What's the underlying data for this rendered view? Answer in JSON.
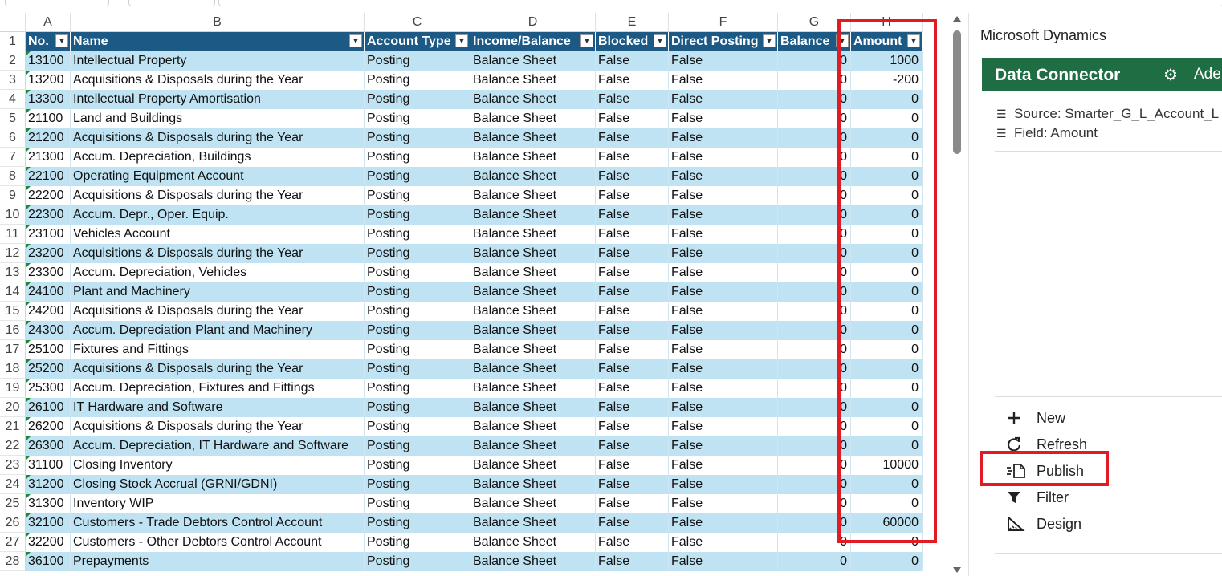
{
  "columns": [
    "A",
    "B",
    "C",
    "D",
    "E",
    "F",
    "G",
    "H"
  ],
  "headers": {
    "no": "No.",
    "name": "Name",
    "account_type": "Account Type",
    "income_balance": "Income/Balance",
    "blocked": "Blocked",
    "direct_posting": "Direct Posting",
    "balance": "Balance",
    "amount": "Amount"
  },
  "rows": [
    {
      "row": "2",
      "no": "13100",
      "name": "Intellectual Property",
      "type": "Posting",
      "ib": "Balance Sheet",
      "blocked": "False",
      "direct": "False",
      "balance": "0",
      "amount": "1000"
    },
    {
      "row": "3",
      "no": "13200",
      "name": "Acquisitions & Disposals during the Year",
      "type": "Posting",
      "ib": "Balance Sheet",
      "blocked": "False",
      "direct": "False",
      "balance": "0",
      "amount": "-200"
    },
    {
      "row": "4",
      "no": "13300",
      "name": "Intellectual Property Amortisation",
      "type": "Posting",
      "ib": "Balance Sheet",
      "blocked": "False",
      "direct": "False",
      "balance": "0",
      "amount": "0"
    },
    {
      "row": "5",
      "no": "21100",
      "name": "Land and Buildings",
      "type": "Posting",
      "ib": "Balance Sheet",
      "blocked": "False",
      "direct": "False",
      "balance": "0",
      "amount": "0"
    },
    {
      "row": "6",
      "no": "21200",
      "name": "Acquisitions & Disposals during the Year",
      "type": "Posting",
      "ib": "Balance Sheet",
      "blocked": "False",
      "direct": "False",
      "balance": "0",
      "amount": "0"
    },
    {
      "row": "7",
      "no": "21300",
      "name": "Accum. Depreciation, Buildings",
      "type": "Posting",
      "ib": "Balance Sheet",
      "blocked": "False",
      "direct": "False",
      "balance": "0",
      "amount": "0"
    },
    {
      "row": "8",
      "no": "22100",
      "name": "Operating Equipment Account",
      "type": "Posting",
      "ib": "Balance Sheet",
      "blocked": "False",
      "direct": "False",
      "balance": "0",
      "amount": "0"
    },
    {
      "row": "9",
      "no": "22200",
      "name": "Acquisitions & Disposals during the Year",
      "type": "Posting",
      "ib": "Balance Sheet",
      "blocked": "False",
      "direct": "False",
      "balance": "0",
      "amount": "0"
    },
    {
      "row": "10",
      "no": "22300",
      "name": "Accum. Depr., Oper. Equip.",
      "type": "Posting",
      "ib": "Balance Sheet",
      "blocked": "False",
      "direct": "False",
      "balance": "0",
      "amount": "0"
    },
    {
      "row": "11",
      "no": "23100",
      "name": "Vehicles Account",
      "type": "Posting",
      "ib": "Balance Sheet",
      "blocked": "False",
      "direct": "False",
      "balance": "0",
      "amount": "0"
    },
    {
      "row": "12",
      "no": "23200",
      "name": "Acquisitions & Disposals during the Year",
      "type": "Posting",
      "ib": "Balance Sheet",
      "blocked": "False",
      "direct": "False",
      "balance": "0",
      "amount": "0"
    },
    {
      "row": "13",
      "no": "23300",
      "name": "Accum. Depreciation, Vehicles",
      "type": "Posting",
      "ib": "Balance Sheet",
      "blocked": "False",
      "direct": "False",
      "balance": "0",
      "amount": "0"
    },
    {
      "row": "14",
      "no": "24100",
      "name": "Plant and Machinery",
      "type": "Posting",
      "ib": "Balance Sheet",
      "blocked": "False",
      "direct": "False",
      "balance": "0",
      "amount": "0"
    },
    {
      "row": "15",
      "no": "24200",
      "name": "Acquisitions & Disposals during the Year",
      "type": "Posting",
      "ib": "Balance Sheet",
      "blocked": "False",
      "direct": "False",
      "balance": "0",
      "amount": "0"
    },
    {
      "row": "16",
      "no": "24300",
      "name": "Accum. Depreciation Plant and Machinery",
      "type": "Posting",
      "ib": "Balance Sheet",
      "blocked": "False",
      "direct": "False",
      "balance": "0",
      "amount": "0"
    },
    {
      "row": "17",
      "no": "25100",
      "name": "Fixtures and Fittings",
      "type": "Posting",
      "ib": "Balance Sheet",
      "blocked": "False",
      "direct": "False",
      "balance": "0",
      "amount": "0"
    },
    {
      "row": "18",
      "no": "25200",
      "name": "Acquisitions & Disposals during the Year",
      "type": "Posting",
      "ib": "Balance Sheet",
      "blocked": "False",
      "direct": "False",
      "balance": "0",
      "amount": "0"
    },
    {
      "row": "19",
      "no": "25300",
      "name": "Accum. Depreciation, Fixtures and Fittings",
      "type": "Posting",
      "ib": "Balance Sheet",
      "blocked": "False",
      "direct": "False",
      "balance": "0",
      "amount": "0"
    },
    {
      "row": "20",
      "no": "26100",
      "name": "IT Hardware and Software",
      "type": "Posting",
      "ib": "Balance Sheet",
      "blocked": "False",
      "direct": "False",
      "balance": "0",
      "amount": "0"
    },
    {
      "row": "21",
      "no": "26200",
      "name": "Acquisitions & Disposals during the Year",
      "type": "Posting",
      "ib": "Balance Sheet",
      "blocked": "False",
      "direct": "False",
      "balance": "0",
      "amount": "0"
    },
    {
      "row": "22",
      "no": "26300",
      "name": "Accum. Depreciation, IT Hardware and Software",
      "type": "Posting",
      "ib": "Balance Sheet",
      "blocked": "False",
      "direct": "False",
      "balance": "0",
      "amount": "0"
    },
    {
      "row": "23",
      "no": "31100",
      "name": "Closing Inventory",
      "type": "Posting",
      "ib": "Balance Sheet",
      "blocked": "False",
      "direct": "False",
      "balance": "0",
      "amount": "10000"
    },
    {
      "row": "24",
      "no": "31200",
      "name": "Closing Stock Accrual (GRNI/GDNI)",
      "type": "Posting",
      "ib": "Balance Sheet",
      "blocked": "False",
      "direct": "False",
      "balance": "0",
      "amount": "0"
    },
    {
      "row": "25",
      "no": "31300",
      "name": "Inventory WIP",
      "type": "Posting",
      "ib": "Balance Sheet",
      "blocked": "False",
      "direct": "False",
      "balance": "0",
      "amount": "0"
    },
    {
      "row": "26",
      "no": "32100",
      "name": "Customers - Trade Debtors Control Account",
      "type": "Posting",
      "ib": "Balance Sheet",
      "blocked": "False",
      "direct": "False",
      "balance": "0",
      "amount": "60000"
    },
    {
      "row": "27",
      "no": "32200",
      "name": "Customers - Other Debtors Control Account",
      "type": "Posting",
      "ib": "Balance Sheet",
      "blocked": "False",
      "direct": "False",
      "balance": "0",
      "amount": "0"
    },
    {
      "row": "28",
      "no": "36100",
      "name": "Prepayments",
      "type": "Posting",
      "ib": "Balance Sheet",
      "blocked": "False",
      "direct": "False",
      "balance": "0",
      "amount": "0"
    }
  ],
  "pane": {
    "title": "Microsoft Dynamics",
    "connector_title": "Data Connector",
    "user": "Adel",
    "source": "Source: Smarter_G_L_Account_L",
    "field": "Field: Amount",
    "actions": {
      "new": "New",
      "refresh": "Refresh",
      "publish": "Publish",
      "filter": "Filter",
      "design": "Design"
    }
  },
  "colors": {
    "header_bg": "#1c5a85",
    "band": "#bfe3f3",
    "connector_bg": "#1f6e43",
    "highlight": "#e01b24"
  }
}
